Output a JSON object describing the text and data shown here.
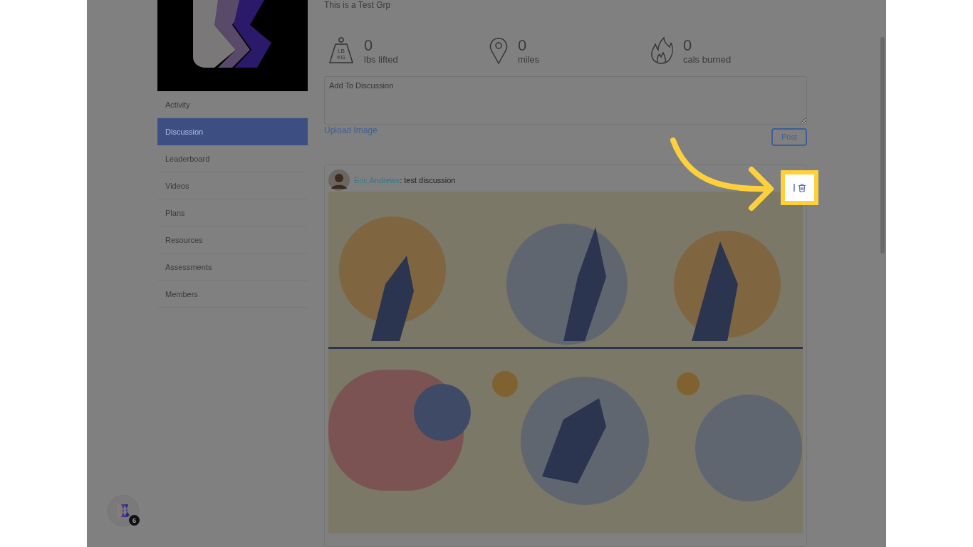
{
  "group_title": "This is a Test Grp",
  "nav": [
    {
      "label": "Activity",
      "selected": false
    },
    {
      "label": "Discussion",
      "selected": true
    },
    {
      "label": "Leaderboard",
      "selected": false
    },
    {
      "label": "Videos",
      "selected": false
    },
    {
      "label": "Plans",
      "selected": false
    },
    {
      "label": "Resources",
      "selected": false
    },
    {
      "label": "Assessments",
      "selected": false
    },
    {
      "label": "Members",
      "selected": false
    }
  ],
  "stats": [
    {
      "kind": "weight",
      "icon_text": [
        "LB",
        "KG"
      ],
      "value": "0",
      "label": "lbs lifted"
    },
    {
      "kind": "pin",
      "value": "0",
      "label": "miles"
    },
    {
      "kind": "flame",
      "value": "0",
      "label": "cals burned"
    }
  ],
  "composer": {
    "placeholder": "Add To Discussion",
    "upload_link": "Upload Image",
    "post_button": "Post"
  },
  "posts": [
    {
      "author": "Eric Andrews",
      "text": ": test discussion"
    }
  ],
  "launcher": {
    "badge": "6"
  }
}
